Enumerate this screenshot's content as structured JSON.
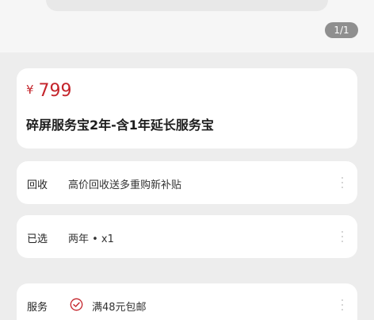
{
  "gallery": {
    "page_indicator": "1/1"
  },
  "product": {
    "currency": "¥",
    "price": "799",
    "title": "碎屏服务宝2年-含1年延长服务宝"
  },
  "rows": {
    "recycle": {
      "label": "回收",
      "value": "高价回收送多重购新补贴"
    },
    "selected": {
      "label": "已选",
      "value": "两年 • x1"
    },
    "service": {
      "label": "服务",
      "value": "满48元包邮"
    }
  },
  "colors": {
    "price": "#c4242b",
    "background": "#ededed",
    "card": "#ffffff",
    "indicator": "#8f8f8f"
  },
  "icons": {
    "service_check": "check-circle-icon",
    "more": "more-vertical-icon"
  }
}
